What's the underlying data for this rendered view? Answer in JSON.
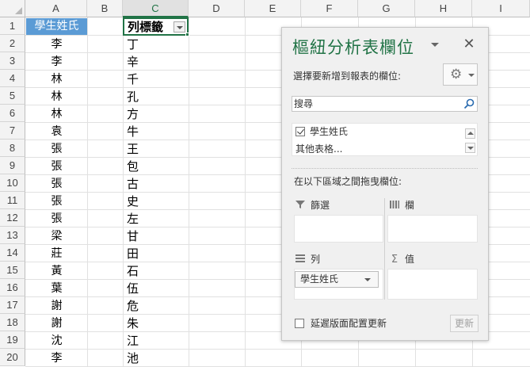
{
  "sheet": {
    "columns": [
      "A",
      "B",
      "C",
      "D",
      "E",
      "F",
      "G",
      "H",
      "I"
    ],
    "rows": [
      "1",
      "2",
      "3",
      "4",
      "5",
      "6",
      "7",
      "8",
      "9",
      "10",
      "11",
      "12",
      "13",
      "14",
      "15",
      "16",
      "17",
      "18",
      "19",
      "20"
    ],
    "a1_header": "學生姓氏",
    "c1_header": "列標籤",
    "col_a": [
      "李",
      "李",
      "林",
      "林",
      "林",
      "袁",
      "張",
      "張",
      "張",
      "張",
      "張",
      "梁",
      "莊",
      "黃",
      "葉",
      "謝",
      "謝",
      "沈",
      "李"
    ],
    "col_c": [
      "丁",
      "辛",
      "千",
      "孔",
      "方",
      "牛",
      "王",
      "包",
      "古",
      "史",
      "左",
      "甘",
      "田",
      "石",
      "伍",
      "危",
      "朱",
      "江",
      "池"
    ]
  },
  "pane": {
    "title": "樞紐分析表欄位",
    "close_glyph": "✕",
    "choose_label": "選擇要新增到報表的欄位:",
    "gear_glyph": "⚙",
    "search_placeholder": "搜尋",
    "fields": [
      {
        "label": "學生姓氏",
        "checked": true
      },
      {
        "label": "其他表格...",
        "checked": false
      }
    ],
    "drag_label": "在以下區域之間拖曳欄位:",
    "areas": {
      "filters": {
        "label": "篩選",
        "icon": "filter-icon"
      },
      "columns": {
        "label": "欄",
        "icon": "columns-icon"
      },
      "rows": {
        "label": "列",
        "icon": "rows-icon"
      },
      "values": {
        "label": "值",
        "icon": "sigma-icon"
      }
    },
    "row_field_chip": "學生姓氏",
    "defer_label": "延遲版面配置更新",
    "update_label": "更新"
  },
  "colors": {
    "accent_green": "#217346",
    "header_blue": "#5b9bd5",
    "pane_bg": "#f0f0f0"
  }
}
